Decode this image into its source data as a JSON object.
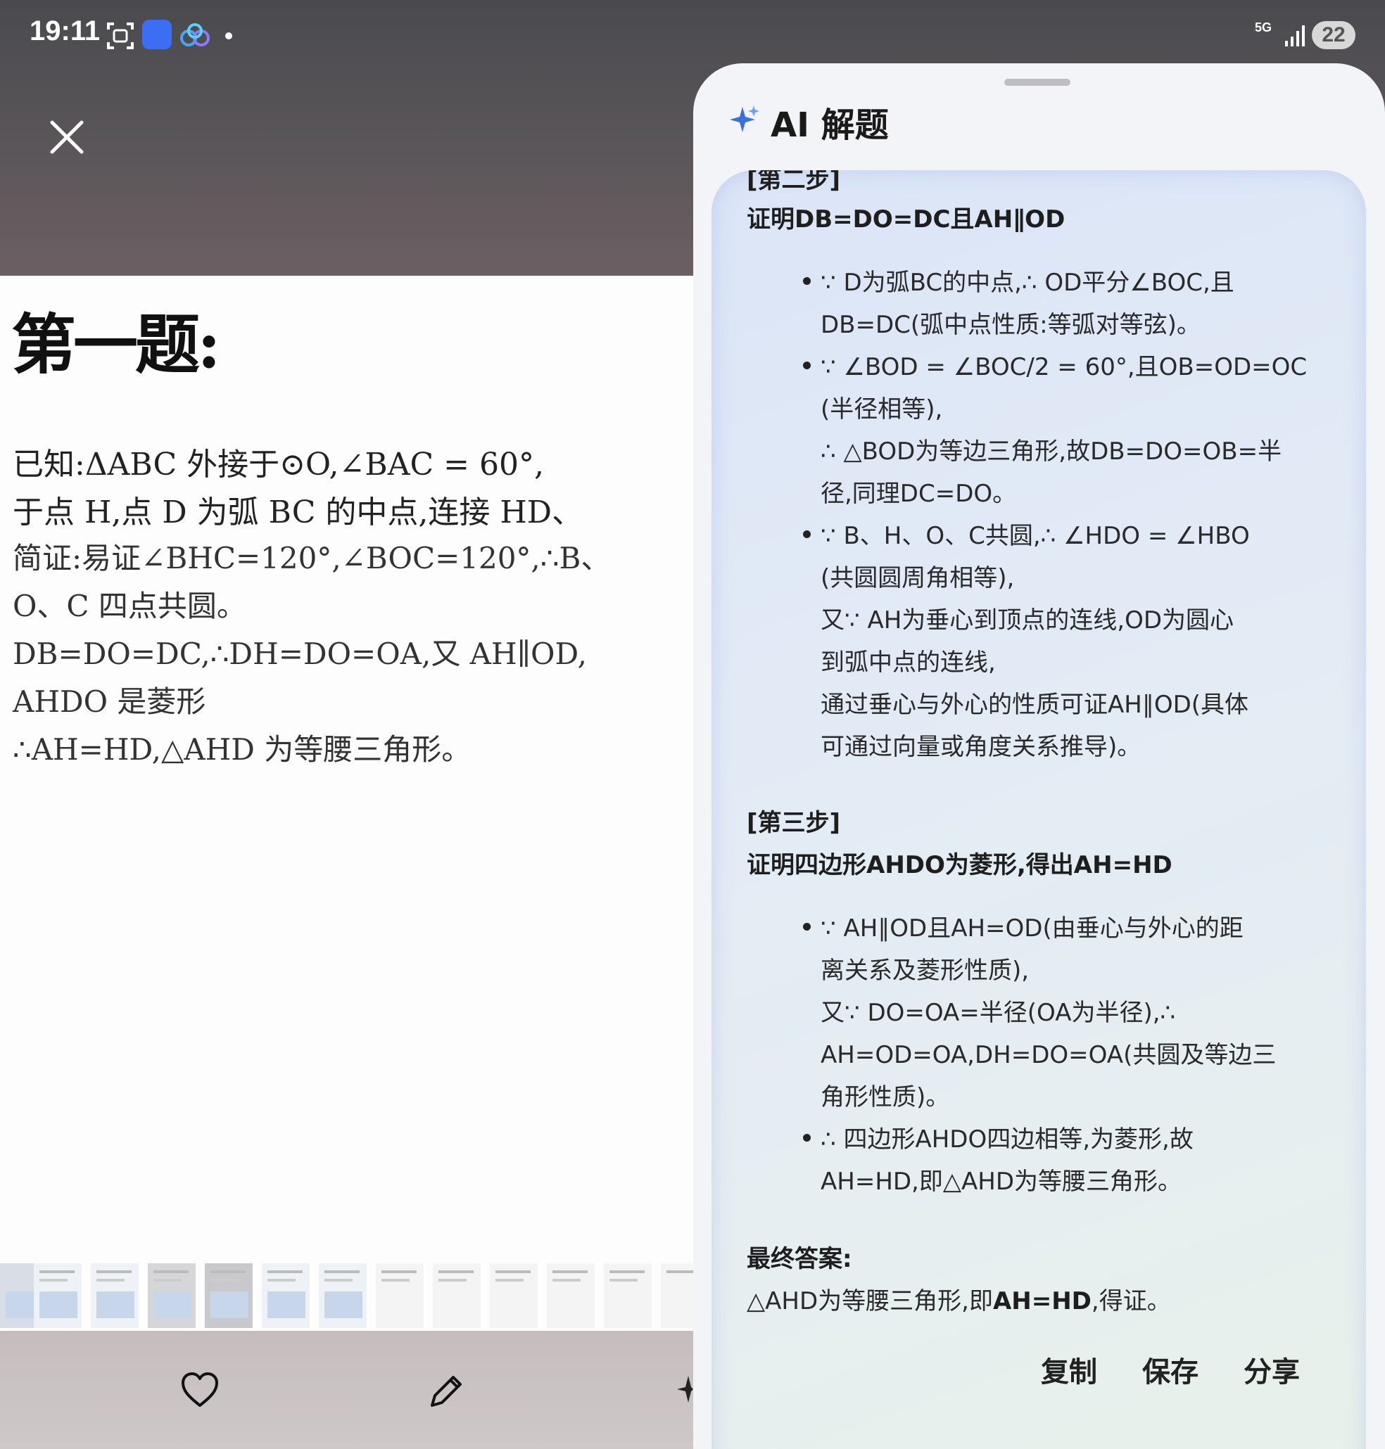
{
  "status_bar": {
    "time": "19:11",
    "network": "5G",
    "battery": "22"
  },
  "document": {
    "title": "第一题:",
    "lines": [
      "已知:ΔABC 外接于⊙O,∠BAC = 60°,",
      "于点 H,点 D 为弧 BC 的中点,连接 HD、",
      "简证:易证∠BHC=120°,∠BOC=120°,∴B、",
      "O、C 四点共圆。",
      "DB=DO=DC,∴DH=DO=OA,又 AH∥OD,",
      "AHDO 是菱形",
      "∴AH=HD,△AHD 为等腰三角形。"
    ]
  },
  "sheet": {
    "title": "AI 解题",
    "step2_cut": "[第二步]",
    "step2_heading": "证明DB=DO=DC且AH∥OD",
    "step2_lines": [
      "∵ D为弧BC的中点,∴ OD平分∠BOC,且",
      "DB=DC(弧中点性质:等弧对等弦)。",
      "∵ ∠BOD = ∠BOC/2 = 60°,且OB=OD=OC",
      "(半径相等),",
      "∴ △BOD为等边三角形,故DB=DO=OB=半",
      "径,同理DC=DO。",
      "∵ B、H、O、C共圆,∴ ∠HDO = ∠HBO",
      "(共圆圆周角相等),",
      "又∵ AH为垂心到顶点的连线,OD为圆心",
      "到弧中点的连线,",
      "通过垂心与外心的性质可证AH∥OD(具体",
      "可通过向量或角度关系推导)。"
    ],
    "step3_label": "[第三步]",
    "step3_heading": "证明四边形AHDO为菱形,得出AH=HD",
    "step3_lines": [
      "∵ AH∥OD且AH=OD(由垂心与外心的距",
      "离关系及菱形性质),",
      "又∵ DO=OA=半径(OA为半径),∴",
      "AH=OD=OA,DH=DO=OA(共圆及等边三",
      "角形性质)。",
      "∴ 四边形AHDO四边相等,为菱形,故",
      "AH=HD,即△AHD为等腰三角形。"
    ],
    "final_label": "最终答案:",
    "final_text_prefix": "△AHD为等腰三角形,即",
    "final_text_bold": "AH=HD",
    "final_text_suffix": ",得证。",
    "actions": {
      "copy": "复制",
      "save": "保存",
      "share": "分享"
    }
  },
  "colors": {
    "accent": "#3a6fe0",
    "sheet_bg": "#f3f4f7"
  }
}
